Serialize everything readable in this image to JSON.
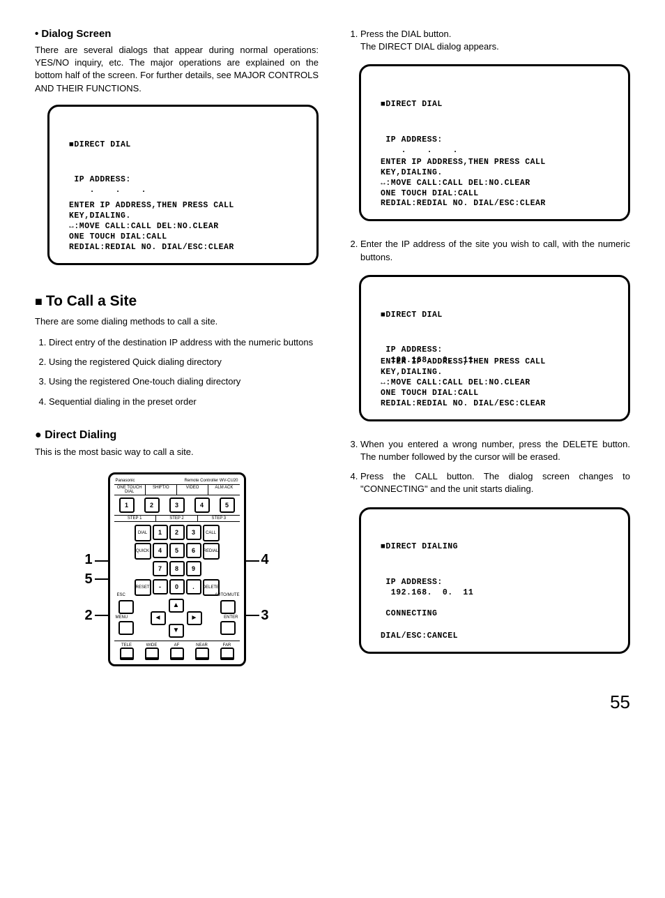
{
  "left": {
    "dialogScreen": {
      "heading": "Dialog Screen",
      "para": "There are several dialogs that appear during normal operations: YES/NO inquiry, etc. The major operations are explained on the bottom half of the screen. For further details, see MAJOR CONTROLS AND THEIR FUNCTIONS."
    },
    "box1": {
      "title": "■DIRECT DIAL",
      "body": " IP ADDRESS:\n    .    .    .",
      "footer": "ENTER IP ADDRESS,THEN PRESS CALL\nKEY,DIALING.\n↔:MOVE CALL:CALL DEL:NO.CLEAR\nONE TOUCH DIAL:CALL\nREDIAL:REDIAL NO. DIAL/ESC:CLEAR"
    },
    "toCall": {
      "heading": "To Call a Site",
      "intro": "There are some dialing methods to call a site.",
      "items": [
        "Direct entry of the destination IP address with the numeric buttons",
        "Using the registered Quick dialing directory",
        "Using the registered One-touch dialing directory",
        "Sequential dialing in the preset order"
      ]
    },
    "directDialing": {
      "heading": "Direct Dialing",
      "intro": "This is the most basic way to call a site."
    },
    "remote": {
      "brand": "Panasonic",
      "model": "Remote Controller WV-CU20",
      "topLblRow": [
        "ONE TOUCH DIAL",
        "SHIFT/O",
        "VIDEO",
        "ALM ACK"
      ],
      "top5": [
        "1",
        "2",
        "3",
        "4",
        "5"
      ],
      "stepTabs": [
        "STEP 1",
        "STEP 2",
        "STEP 3"
      ],
      "sideLabels": {
        "topLeft": "DIAL",
        "topRight": "CALL",
        "midLeft": "QUICK",
        "midRight": "REDIAL",
        "botLeft": "RESET",
        "botMid": "SET",
        "botRight": "DELETE"
      },
      "numpad": [
        "1",
        "2",
        "3",
        "4",
        "5",
        "6",
        "7",
        "8",
        "9",
        "-",
        "0",
        "."
      ],
      "arrowLabels": {
        "esc": "ESC",
        "menu": "MENU",
        "enter": "ENTER",
        "auto": "AUTO/MUTE"
      },
      "bottomLabels": [
        "TELE",
        "WIDE",
        "AF",
        "NEAR",
        "FAR"
      ],
      "callouts": {
        "c1": "1",
        "c2": "2",
        "c3": "3",
        "c4": "4",
        "c5": "5"
      }
    }
  },
  "right": {
    "step1": "Press the DIAL button.\nThe DIRECT DIAL dialog appears.",
    "box1": {
      "title": "■DIRECT DIAL",
      "body": " IP ADDRESS:\n    .    .    .",
      "footer": "ENTER IP ADDRESS,THEN PRESS CALL\nKEY,DIALING.\n↔:MOVE CALL:CALL DEL:NO.CLEAR\nONE TOUCH DIAL:CALL\nREDIAL:REDIAL NO. DIAL/ESC:CLEAR"
    },
    "step2": "Enter the IP address of the site you wish to call, with the numeric buttons.",
    "box2": {
      "title": "■DIRECT DIAL",
      "body": " IP ADDRESS:\n  192.168.  0.  11",
      "footer": "ENTER IP ADDRESS,THEN PRESS CALL\nKEY,DIALING.\n↔:MOVE CALL:CALL DEL:NO.CLEAR\nONE TOUCH DIAL:CALL\nREDIAL:REDIAL NO. DIAL/ESC:CLEAR"
    },
    "step3": "When you entered a wrong number, press the DELETE button. The number followed by the cursor will be erased.",
    "step4": "Press the CALL button. The dialog screen changes to \"CONNECTING\" and the unit starts dialing.",
    "box3": {
      "title": "■DIRECT DIALING",
      "body": " IP ADDRESS:\n  192.168.  0.  11\n\n CONNECTING",
      "footer": "DIAL/ESC:CANCEL"
    }
  },
  "pageNumber": "55"
}
